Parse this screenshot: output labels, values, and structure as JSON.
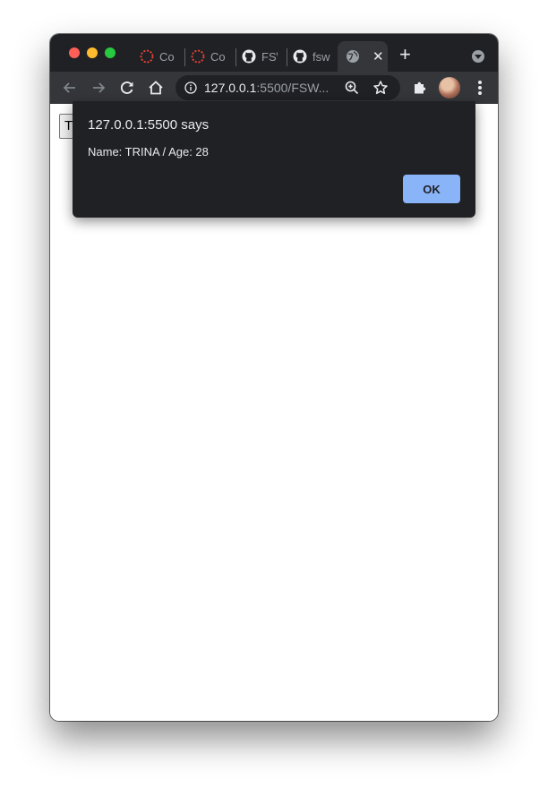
{
  "browser": {
    "tabs": [
      {
        "label": "Co",
        "icon": "spinner-icon"
      },
      {
        "label": "Co",
        "icon": "spinner-icon"
      },
      {
        "label": "FS\\",
        "icon": "github-icon"
      },
      {
        "label": "fsw",
        "icon": "github-icon"
      },
      {
        "label": "",
        "icon": "globe-icon",
        "active": true
      }
    ],
    "new_tab_label": "+",
    "close_label": "✕",
    "url_host": "127.0.0.1",
    "url_rest": ":5500/FSW...",
    "colors": {
      "tabstrip": "#202124",
      "toolbar": "#35363a",
      "accent_button": "#8ab4f8"
    }
  },
  "page": {
    "button_label": "Try"
  },
  "dialog": {
    "title": "127.0.0.1:5500 says",
    "message": "Name: TRINA / Age: 28",
    "ok_label": "OK"
  }
}
